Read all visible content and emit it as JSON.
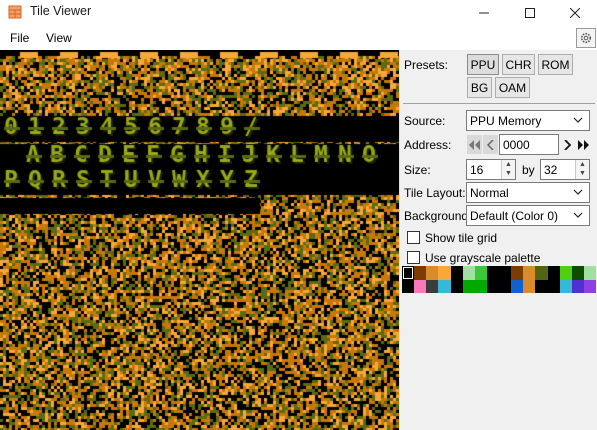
{
  "window": {
    "title": "Tile Viewer",
    "icon": "tile-viewer-app-icon"
  },
  "menu": {
    "file": "File",
    "view": "View",
    "settings_icon": "gear-icon"
  },
  "presets": {
    "label": "Presets:",
    "buttons": [
      "PPU",
      "CHR",
      "ROM",
      "BG",
      "OAM"
    ],
    "active": "PPU"
  },
  "source": {
    "label": "Source:",
    "value": "PPU Memory"
  },
  "address": {
    "label": "Address:",
    "value": "0000",
    "nav_icons": [
      "first-page-icon",
      "previous-page-icon",
      "next-page-icon",
      "last-page-icon"
    ]
  },
  "size": {
    "label": "Size:",
    "width": "16",
    "by_label": "by",
    "height": "32"
  },
  "tile_layout": {
    "label": "Tile Layout:",
    "value": "Normal"
  },
  "background": {
    "label": "Background:",
    "value": "Default (Color 0)"
  },
  "options": {
    "show_tile_grid": "Show tile grid",
    "show_tile_grid_checked": false,
    "use_grayscale_palette": "Use grayscale palette",
    "use_grayscale_palette_checked": false
  },
  "palette": {
    "row1": [
      "#000000",
      "#7c3c00",
      "#d88c2c",
      "#f8a838",
      "#000000",
      "#a0e0a0",
      "#38c838",
      "#000000",
      "#000000",
      "#7c3c00",
      "#d88c2c",
      "#506414",
      "#000000",
      "#50d010",
      "#104c00",
      "#a0e0a0"
    ],
    "row2": [
      "#000000",
      "#f878b8",
      "#3c3c3c",
      "#38b8d8",
      "#000000",
      "#00a800",
      "#00a800",
      "#000000",
      "#000000",
      "#1060d0",
      "#d88c2c",
      "#000000",
      "#000000",
      "#38b8d8",
      "#5030d0",
      "#9040e0"
    ]
  },
  "tile_view": {
    "text_rows": [
      "0123456789/",
      "ABCDEFGHIJKLMNO",
      "PQRSTUVWXYZ"
    ],
    "colors": [
      "#000000",
      "#5a6b12",
      "#c87808",
      "#f8a838"
    ]
  }
}
